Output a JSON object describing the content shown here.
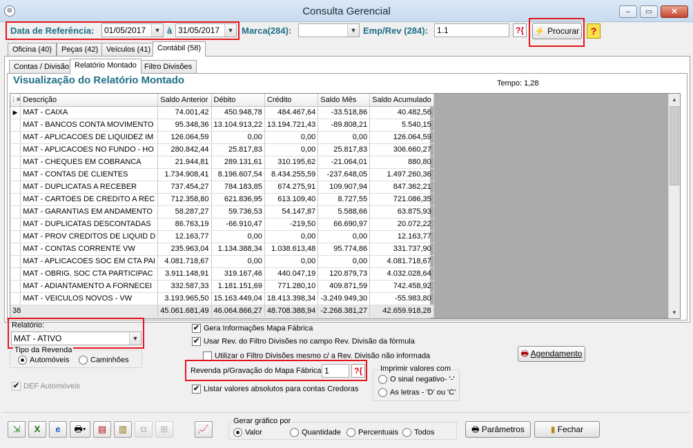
{
  "window": {
    "title": "Consulta Gerencial",
    "app_icon": "vw-logo-icon",
    "buttons": {
      "minimize": "‒",
      "maximize": "▭",
      "close": "✕"
    }
  },
  "filters": {
    "data_ref_label": "Data de Referência:",
    "date_from": "01/05/2017",
    "date_sep": "à",
    "date_to": "31/05/2017",
    "marca_label": "Marca(284):",
    "marca_value": "",
    "emp_rev_label": "Emp/Rev (284):",
    "emp_rev_value": "1.1",
    "lookup_icon": "?{",
    "procurar_label": "Procurar",
    "help_icon": "?"
  },
  "tabs_main": [
    {
      "label": "Oficina (40)"
    },
    {
      "label": "Peças (42)"
    },
    {
      "label": "Veículos (41)"
    },
    {
      "label": "Contábil (58)"
    }
  ],
  "tabs_sub": [
    {
      "label": "Contas / Divisão"
    },
    {
      "label": "Relatório Montado"
    },
    {
      "label": "Filtro Divisões"
    }
  ],
  "report": {
    "heading": "Visualização do Relatório Montado",
    "tempo": "Tempo: 1,28"
  },
  "grid": {
    "header_icon": "⋮≡",
    "columns": [
      "Descrição",
      "Saldo Anterior",
      "Débito",
      "Crédito",
      "Saldo Mês",
      "Saldo Acumulado"
    ],
    "rows": [
      [
        "MAT - CAIXA",
        "74.001,42",
        "450.948,78",
        "484.467,64",
        "-33.518,86",
        "40.482,56"
      ],
      [
        "MAT - BANCOS CONTA MOVIMENTO",
        "95.348,36",
        "13.104.913,22",
        "13.194.721,43",
        "-89.808,21",
        "5.540,15"
      ],
      [
        "MAT - APLICACOES DE LIQUIDEZ IM",
        "126.064,59",
        "0,00",
        "0,00",
        "0,00",
        "126.064,59"
      ],
      [
        "MAT - APLICACOES NO FUNDO - HO",
        "280.842,44",
        "25.817,83",
        "0,00",
        "25.817,83",
        "306.660,27"
      ],
      [
        "MAT - CHEQUES EM COBRANCA",
        "21.944,81",
        "289.131,61",
        "310.195,62",
        "-21.064,01",
        "880,80"
      ],
      [
        "MAT - CONTAS DE CLIENTES",
        "1.734.908,41",
        "8.196.607,54",
        "8.434.255,59",
        "-237.648,05",
        "1.497.260,36"
      ],
      [
        "MAT - DUPLICATAS A RECEBER",
        "737.454,27",
        "784.183,85",
        "674.275,91",
        "109.907,94",
        "847.362,21"
      ],
      [
        "MAT - CARTOES DE CREDITO A REC",
        "712.358,80",
        "621.836,95",
        "613.109,40",
        "8.727,55",
        "721.086,35"
      ],
      [
        "MAT - GARANTIAS EM ANDAMENTO",
        "58.287,27",
        "59.736,53",
        "54.147,87",
        "5.588,66",
        "63.875,93"
      ],
      [
        "MAT - DUPLICATAS DESCONTADAS",
        "86.763,19",
        "-66.910,47",
        "-219,50",
        "66.690,97",
        "20.072,22"
      ],
      [
        "MAT - PROV CREDITOS DE LIQUID D",
        "12.163,77",
        "0,00",
        "0,00",
        "0,00",
        "12.163,77"
      ],
      [
        "MAT - CONTAS CORRENTE VW",
        "235.963,04",
        "1.134.388,34",
        "1.038.613,48",
        "95.774,86",
        "331.737,90"
      ],
      [
        "MAT - APLICACOES SOC EM CTA PAI",
        "4.081.718,67",
        "0,00",
        "0,00",
        "0,00",
        "4.081.718,67"
      ],
      [
        "MAT - OBRIG. SOC CTA PARTICIPAC",
        "3.911.148,91",
        "319.167,46",
        "440.047,19",
        "120.879,73",
        "4.032.028,64"
      ],
      [
        "MAT - ADIANTAMENTO A FORNECEI",
        "332.587,33",
        "1.181.151,69",
        "771.280,10",
        "409.871,59",
        "742.458,92"
      ],
      [
        "MAT - VEICULOS NOVOS - VW",
        "3.193.965,50",
        "15.163.449,04",
        "18.413.398,34",
        "-3.249.949,30",
        "-55.983,80"
      ]
    ],
    "footer": [
      "38",
      "45.061.681,49",
      "46.064.866,27",
      "48.708.388,94",
      "-2.268.381,27",
      "42.659.918,28"
    ]
  },
  "options": {
    "relatorio_label": "Relatório:",
    "relatorio_value": "MAT - ATIVO",
    "tipo_revenda_label": "Tipo da Revenda",
    "tipo_automoveis": "Automóveis",
    "tipo_caminhoes": "Caminhões",
    "def_automoveis": "DEF Automóveis",
    "gera_info": "Gera Informações Mapa Fábrica",
    "usar_rev": "Usar Rev. do Filtro Divisões no campo Rev. Divisão da fórmula",
    "utilizar_filtro": "Utilizar o Filtro Divisões mesmo c/ a Rev. Divisão não informada",
    "revenda_gravacao_label": "Revenda p/Gravação do Mapa Fábrica",
    "revenda_gravacao_value": "1",
    "listar_absolutos": "Listar valores absolutos para contas Credoras",
    "imprimir_label": "Imprimir valores com",
    "sinal_negativo": "O sinal negativo- '-'",
    "as_letras": "As letras - 'D' ou  'C'",
    "agendamento": "Agendamento"
  },
  "bottom": {
    "gerar_grafico_label": "Gerar gráfico por",
    "grafico_options": [
      "Valor",
      "Quantidade",
      "Percentuais",
      "Todos"
    ],
    "parametros": "Parâmetros",
    "fechar": "Fechar"
  }
}
